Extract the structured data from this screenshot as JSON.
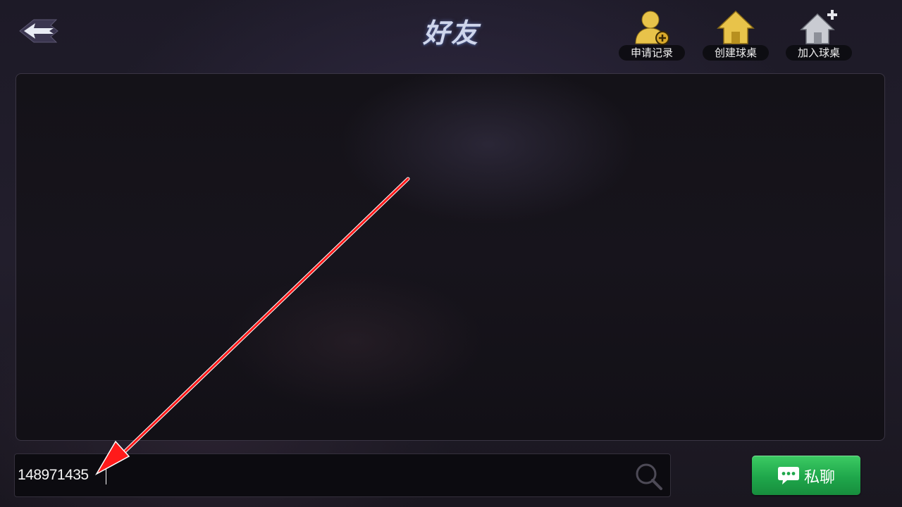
{
  "header": {
    "title": "好友",
    "back_icon": "back-arrow-icon",
    "actions": [
      {
        "id": "apply",
        "label": "申请记录",
        "icon": "user-add-icon",
        "color": "#e8c34a"
      },
      {
        "id": "create",
        "label": "创建球桌",
        "icon": "house-icon",
        "color": "#e8c34a"
      },
      {
        "id": "join",
        "label": "加入球桌",
        "icon": "house-plus-icon",
        "color": "#c9cbd2"
      }
    ]
  },
  "content": {
    "friends": []
  },
  "search": {
    "value": "148971435",
    "icon": "search-icon"
  },
  "chat_button": {
    "label": "私聊",
    "icon": "chat-bubble-icon",
    "color": "#22a84c"
  },
  "annotation": {
    "type": "arrow",
    "color": "#ff1a1a"
  }
}
